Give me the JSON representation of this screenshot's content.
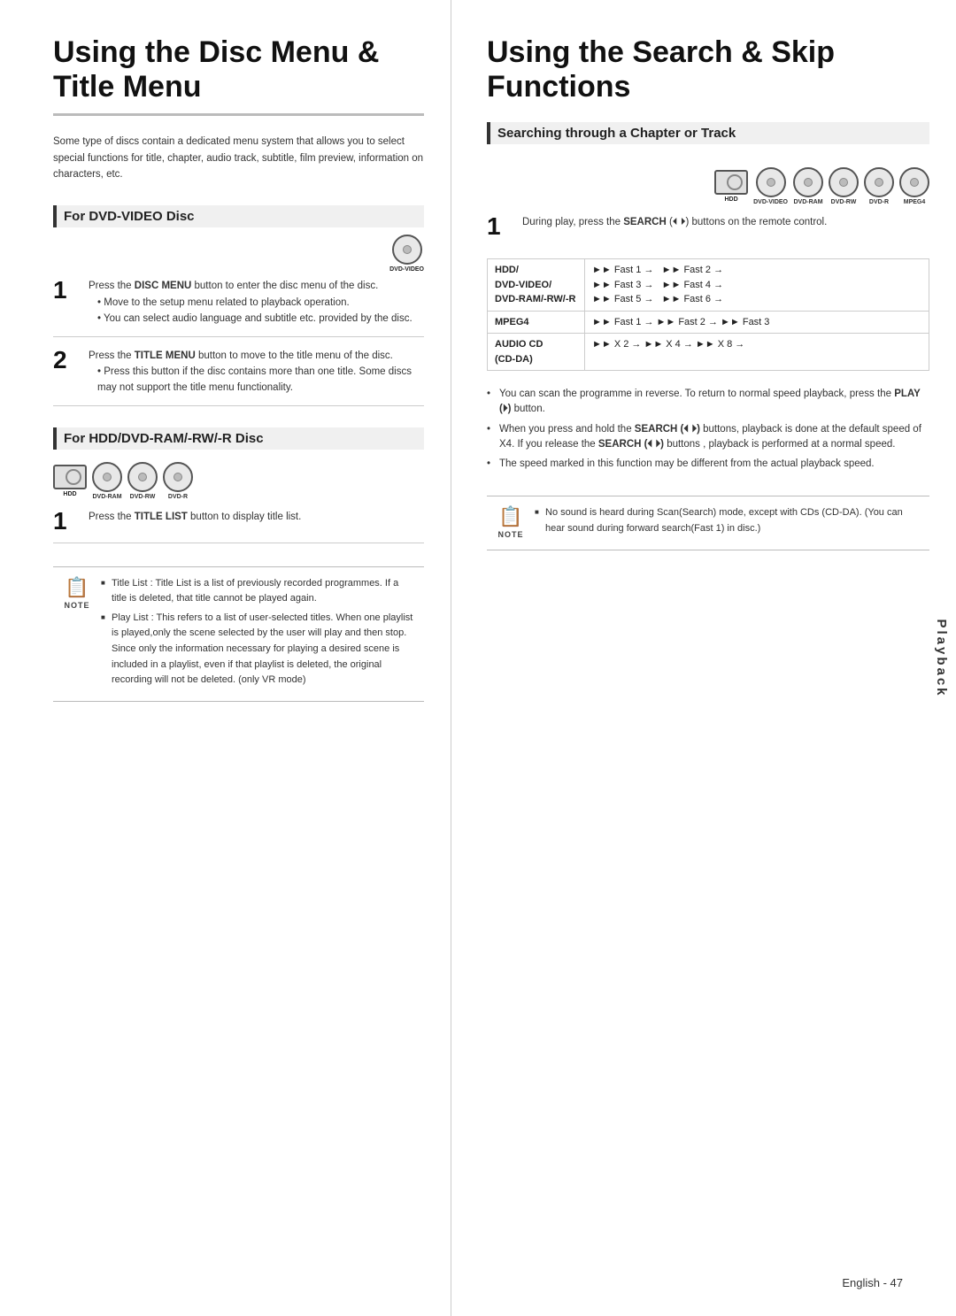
{
  "left": {
    "title": "Using the Disc Menu & Title Menu",
    "intro": "Some type of discs contain a dedicated menu system that allows you to select special functions for title, chapter, audio track, subtitle, film preview, information on characters, etc.",
    "section1": {
      "heading": "For DVD-VIDEO Disc",
      "step1": {
        "num": "1",
        "main": "Press the DISC MENU button to enter the disc menu of the disc.",
        "bullets": [
          "Move to the setup menu related to playback operation.",
          "You can select audio language and subtitle etc. provided by the disc."
        ]
      },
      "step2": {
        "num": "2",
        "main": "Press the TITLE MENU button to move to the title menu of the disc.",
        "bullets": [
          "Press this button if the disc contains more than one title. Some discs may not support the title menu functionality."
        ]
      }
    },
    "section2": {
      "heading": "For HDD/DVD-RAM/-RW/-R Disc",
      "step1": {
        "num": "1",
        "main": "Press the TITLE LIST button to display title list."
      }
    },
    "note": {
      "label": "NOTE",
      "items": [
        "Title List : Title List is a list of previously recorded programmes. If a title is deleted, that title cannot be played again.",
        "Play List : This refers to a list of user-selected titles. When one playlist is played,only the scene selected by the user will play and then stop. Since only the information necessary for playing a desired scene is included in a playlist, even if that playlist is deleted, the original recording will not be deleted. (only VR mode)"
      ]
    }
  },
  "right": {
    "title": "Using the Search & Skip Functions",
    "section1": {
      "heading": "Searching through a Chapter or Track",
      "step1": {
        "num": "1",
        "main": "During play, press the SEARCH (",
        "main2": ") buttons on the remote control."
      },
      "table": {
        "rows": [
          {
            "label": "HDD/\nDVD-VIDEO/\nDVD-RAM/-RW/-R",
            "col1": "►► Fast 1 →   ►► Fast 2 →\n►► Fast 3 →   ►► Fast 4 →\n►► Fast 5 →   ►► Fast 6 →"
          },
          {
            "label": "MPEG4",
            "col1": "►► Fast 1 → ►► Fast 2 → ►► Fast 3"
          },
          {
            "label": "AUDIO CD\n(CD-DA)",
            "col1": "►► X 2 → ►► X 4 → ►► X 8 →"
          }
        ]
      },
      "bullets": [
        "You can scan the programme in reverse. To return to normal speed playback, press the PLAY (  ) button.",
        "When you press and hold the SEARCH (  ) buttons, playback is done at the default speed of X4. If you release the SEARCH (  ) buttons , playback is performed at a normal speed.",
        "The speed marked in this function may be different from the actual playback speed."
      ]
    },
    "note": {
      "label": "NOTE",
      "items": [
        "No sound is heard during Scan(Search) mode, except with CDs (CD-DA). (You can hear sound during forward search(Fast 1) in disc.)"
      ]
    }
  },
  "footer": {
    "text": "English - 47"
  },
  "sidebar": {
    "label": "Playback"
  }
}
